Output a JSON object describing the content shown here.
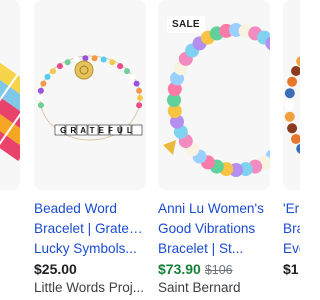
{
  "products": [
    {
      "title_lines": [
        "",
        "",
        ""
      ],
      "price": "",
      "old_price": "",
      "seller": "",
      "badge": "",
      "image_icon": "beaded-wrap-bracelet-image"
    },
    {
      "title_lines": [
        "Beaded Word",
        "Bracelet | Grateful-",
        "Lucky Symbols..."
      ],
      "price": "$25.00",
      "old_price": "",
      "seller": "Little Words Proj...",
      "badge": "",
      "image_icon": "grateful-word-bracelet-image",
      "image_text": "GRATEFUL"
    },
    {
      "title_lines": [
        "Anni Lu Women's",
        "Good Vibrations",
        "Bracelet | St..."
      ],
      "price": "$73.90",
      "old_price": "$106",
      "seller": "Saint Bernard",
      "badge": "SALE",
      "image_icon": "colorful-bead-bracelet-image"
    },
    {
      "title_lines": [
        "'Er",
        "Bra",
        "Eve"
      ],
      "price": "$1",
      "old_price": "",
      "seller": "",
      "badge": "",
      "image_icon": "orange-bead-bracelet-image"
    }
  ],
  "colors": {
    "link": "#1a4ccf",
    "sale_price": "#188038",
    "image_bg": "#f7f7f7"
  }
}
